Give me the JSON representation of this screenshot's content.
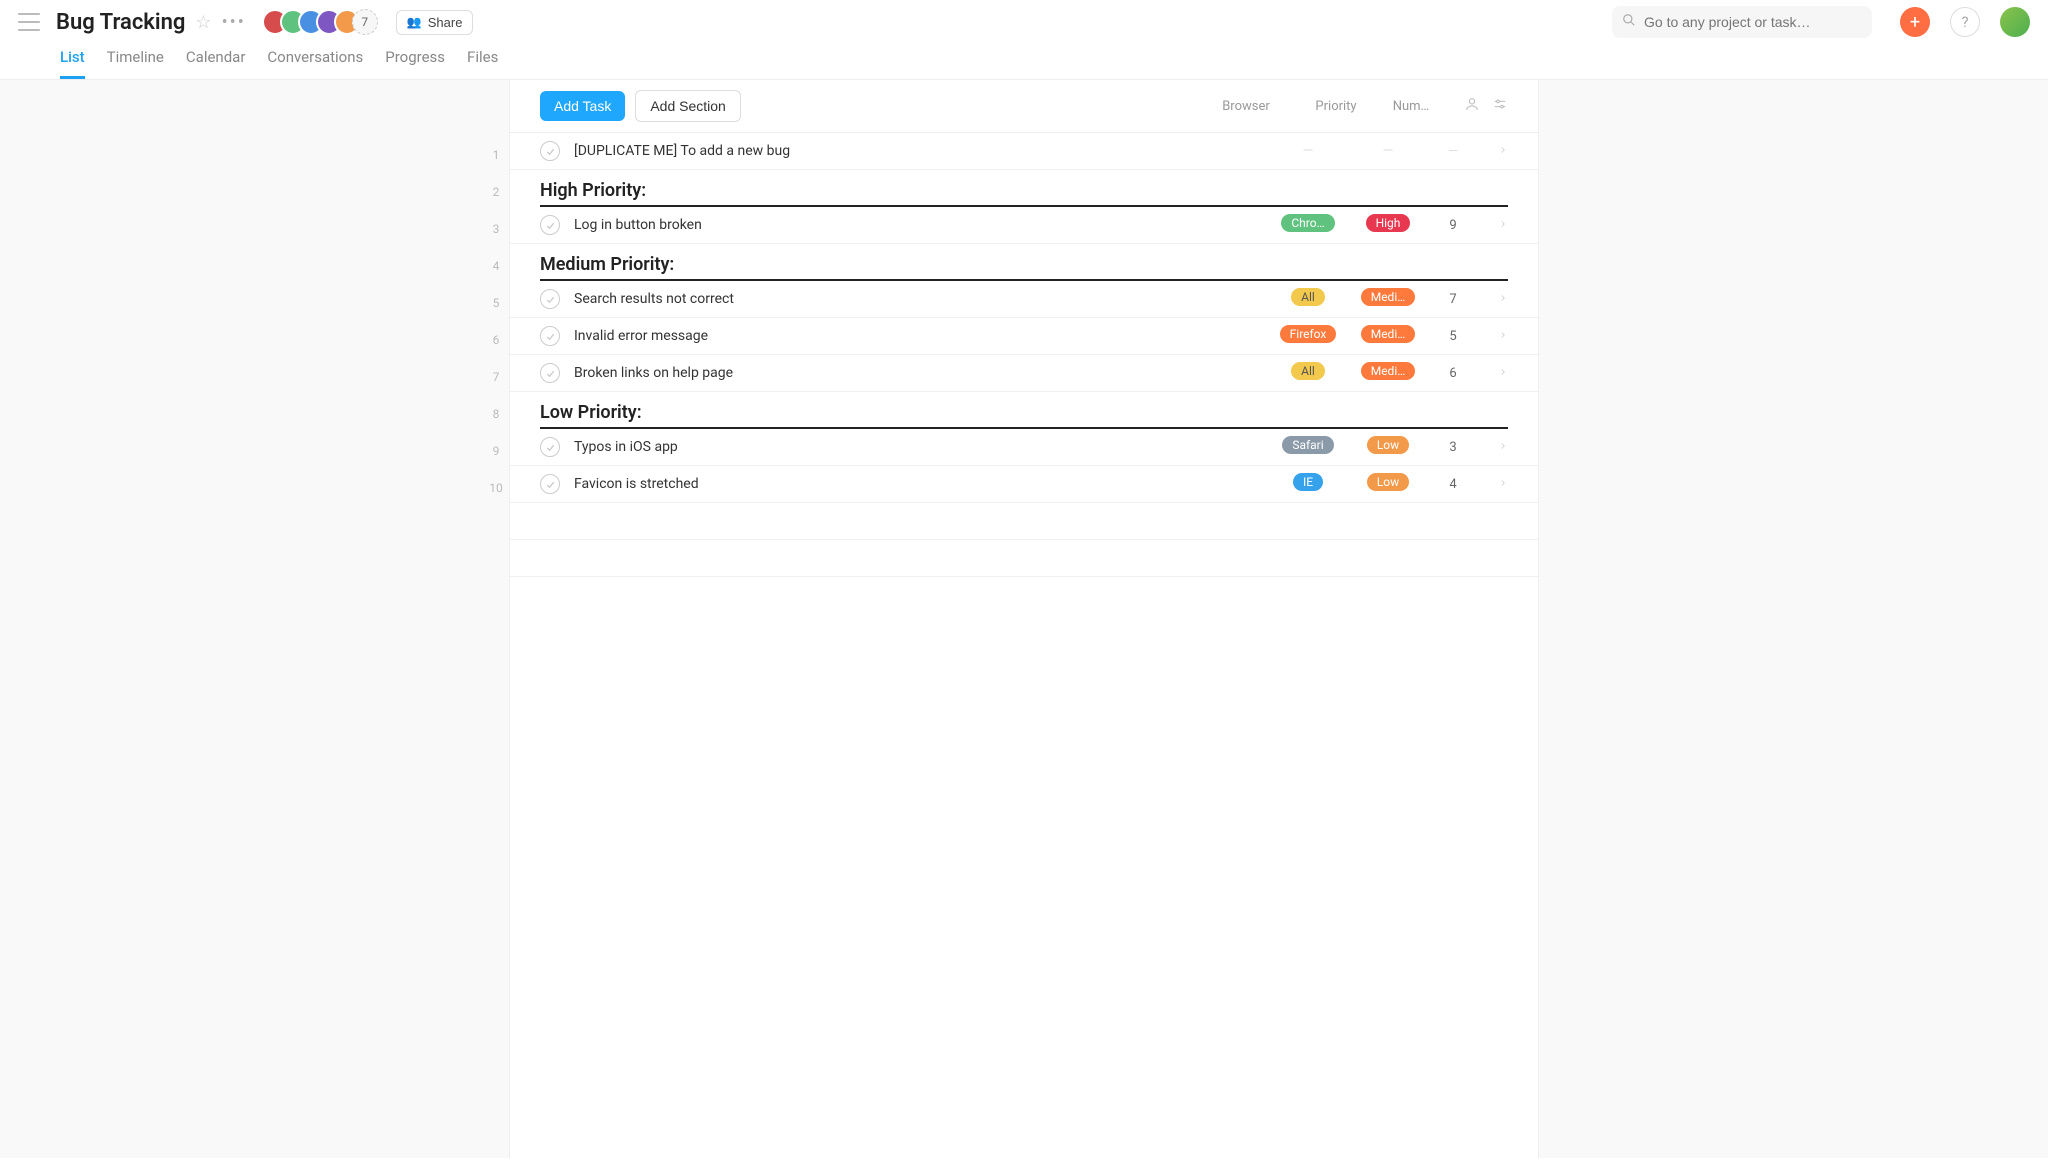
{
  "header": {
    "project_title": "Bug Tracking",
    "share_label": "Share",
    "avatar_overflow_count": "7",
    "avatar_colors": [
      "#d64b4b",
      "#5fc27e",
      "#4a90e2",
      "#7e57c2",
      "#f2994a"
    ],
    "search_placeholder": "Go to any project or task…"
  },
  "tabs": [
    "List",
    "Timeline",
    "Calendar",
    "Conversations",
    "Progress",
    "Files"
  ],
  "active_tab": "List",
  "toolbar": {
    "add_task": "Add Task",
    "add_section": "Add Section",
    "columns": {
      "browser": "Browser",
      "priority": "Priority",
      "number": "Num…"
    }
  },
  "list": [
    {
      "rownum": "1",
      "type": "task",
      "name": "[DUPLICATE ME] To add a new bug",
      "browser": null,
      "priority": null,
      "number": null
    },
    {
      "rownum": "2",
      "type": "section",
      "name": "High Priority:"
    },
    {
      "rownum": "3",
      "type": "task",
      "name": "Log in button broken",
      "browser": "Chro…",
      "browser_class": "pill-chrome",
      "priority": "High",
      "priority_class": "pill-high",
      "number": "9"
    },
    {
      "rownum": "4",
      "type": "section",
      "name": "Medium Priority:"
    },
    {
      "rownum": "5",
      "type": "task",
      "name": "Search results not correct",
      "browser": "All",
      "browser_class": "pill-all",
      "priority": "Medi…",
      "priority_class": "pill-medium",
      "number": "7"
    },
    {
      "rownum": "6",
      "type": "task",
      "name": "Invalid error message",
      "browser": "Firefox",
      "browser_class": "pill-firefox",
      "priority": "Medi…",
      "priority_class": "pill-medium",
      "number": "5"
    },
    {
      "rownum": "7",
      "type": "task",
      "name": "Broken links on help page",
      "browser": "All",
      "browser_class": "pill-all",
      "priority": "Medi…",
      "priority_class": "pill-medium",
      "number": "6"
    },
    {
      "rownum": "8",
      "type": "section",
      "name": "Low Priority:"
    },
    {
      "rownum": "9",
      "type": "task",
      "name": "Typos in iOS app",
      "browser": "Safari",
      "browser_class": "pill-safari",
      "priority": "Low",
      "priority_class": "pill-low",
      "number": "3"
    },
    {
      "rownum": "10",
      "type": "task",
      "name": "Favicon is stretched",
      "browser": "IE",
      "browser_class": "pill-ie",
      "priority": "Low",
      "priority_class": "pill-low",
      "number": "4"
    }
  ]
}
